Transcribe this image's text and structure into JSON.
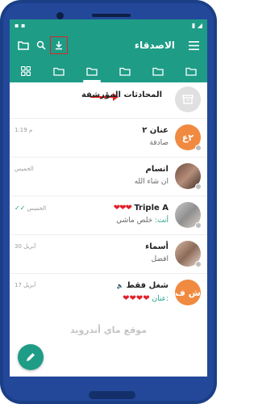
{
  "colors": {
    "primary": "#1e9c86",
    "accent_red": "#e02020",
    "heart": "#e0202a"
  },
  "appbar": {
    "title": "الاصدقاء"
  },
  "tabs": [
    {
      "icon": "all-chats-icon",
      "active": false
    },
    {
      "icon": "folder-icon",
      "active": false
    },
    {
      "icon": "folder-icon",
      "active": true
    },
    {
      "icon": "folder-icon",
      "active": false
    },
    {
      "icon": "folder-icon",
      "active": false
    },
    {
      "icon": "folder-icon",
      "active": false
    }
  ],
  "archived": {
    "label": "المحادثات المؤرشفة"
  },
  "chats": [
    {
      "name": "عنان ٢",
      "message": "صادقة",
      "time": "1:19 م",
      "avatar_text": "٢ع"
    },
    {
      "name": "انسام",
      "message": "ان شاء الله",
      "time": "الخميس"
    },
    {
      "name": "Triple A",
      "name_hearts": "❤❤❤",
      "sender": "أنت:",
      "message": "خلص ماشي",
      "time": "الخميس"
    },
    {
      "name": "أسماء",
      "message": "افضل",
      "time": "30 أبريل"
    },
    {
      "name": "شغل فقط",
      "sender": "عنان:",
      "message_hearts": "❤❤❤❤",
      "time": "17 أبريل",
      "avatar_text": "ش ف"
    }
  ],
  "watermark": "موقع ماي أندرويد"
}
